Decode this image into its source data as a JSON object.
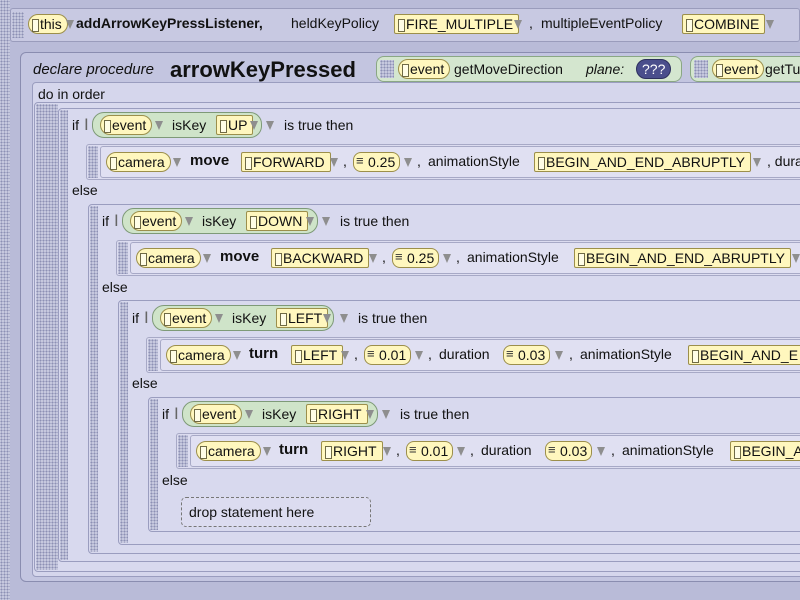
{
  "header": {
    "this_label": "this",
    "method_name": "addArrowKeyPressListener,",
    "held_key_policy_label": "heldKeyPolicy",
    "held_key_policy_value": "FIRE_MULTIPLE",
    "comma": ",",
    "multiple_event_policy_label": "multipleEventPolicy",
    "multiple_event_policy_value": "COMBINE"
  },
  "procedure": {
    "declare_label": "declare procedure",
    "name": "arrowKeyPressed",
    "param_event_1": "event",
    "get_move_direction": "getMoveDirection",
    "plane_label": "plane:",
    "plane_value": "???",
    "param_event_2": "event",
    "get_tu": "getTu"
  },
  "do_in_order": "do in order",
  "if_blocks": [
    {
      "if_label": "if",
      "event": "event",
      "is_key": "isKey",
      "key": "UP",
      "then": "is true then",
      "object": "camera",
      "method": "move",
      "direction": "FORWARD",
      "amount": "0.25",
      "anim_label": "animationStyle",
      "anim_value": "BEGIN_AND_END_ABRUPTLY",
      "trailing": ", dura"
    },
    {
      "else_label": "else",
      "if_label": "if",
      "event": "event",
      "is_key": "isKey",
      "key": "DOWN",
      "then": "is true then",
      "object": "camera",
      "method": "move",
      "direction": "BACKWARD",
      "amount": "0.25",
      "anim_label": "animationStyle",
      "anim_value": "BEGIN_AND_END_ABRUPTLY"
    },
    {
      "else_label": "else",
      "if_label": "if",
      "event": "event",
      "is_key": "isKey",
      "key": "LEFT",
      "then": "is true then",
      "object": "camera",
      "method": "turn",
      "direction": "LEFT",
      "amount": "0.01",
      "duration_label": "duration",
      "duration_value": "0.03",
      "anim_label": "animationStyle",
      "anim_value": "BEGIN_AND_E"
    },
    {
      "else_label": "else",
      "if_label": "if",
      "event": "event",
      "is_key": "isKey",
      "key": "RIGHT",
      "then": "is true then",
      "object": "camera",
      "method": "turn",
      "direction": "RIGHT",
      "amount": "0.01",
      "duration_label": "duration",
      "duration_value": "0.03",
      "anim_label": "animationStyle",
      "anim_value": "BEGIN_A"
    }
  ],
  "final_else": "else",
  "drop_placeholder": "drop statement here",
  "sep": ","
}
